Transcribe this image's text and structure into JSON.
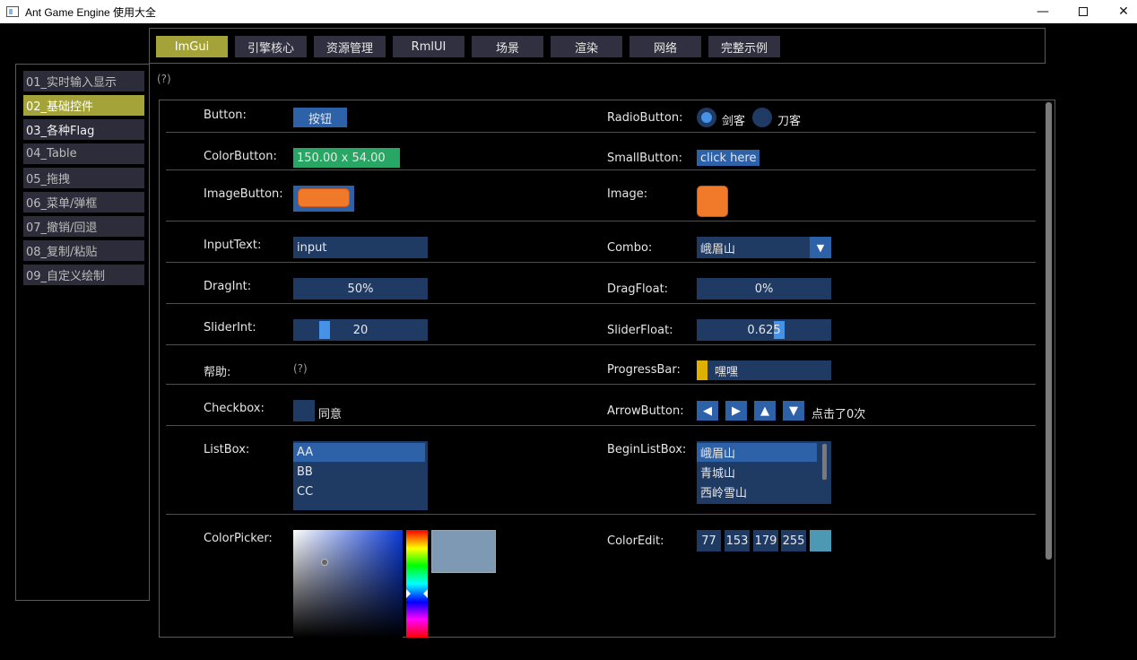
{
  "window": {
    "title": "Ant Game Engine 使用大全",
    "min_glyph": "—",
    "close_glyph": "✕"
  },
  "top_tabs": [
    {
      "label": "ImGui",
      "active": true
    },
    {
      "label": "引擎核心"
    },
    {
      "label": "资源管理"
    },
    {
      "label": "RmlUI"
    },
    {
      "label": "场景"
    },
    {
      "label": "渲染"
    },
    {
      "label": "网络"
    },
    {
      "label": "完整示例"
    }
  ],
  "sidebar": [
    {
      "label": "01_实时输入显示"
    },
    {
      "label": "02_基础控件",
      "active": true
    },
    {
      "label": "03_各种Flag"
    },
    {
      "label": "04_Table"
    },
    {
      "label": "05_拖拽"
    },
    {
      "label": "06_菜单/弹框"
    },
    {
      "label": "07_撤销/回退"
    },
    {
      "label": "08_复制/粘贴"
    },
    {
      "label": "09_自定义绘制"
    }
  ],
  "help_marker": "(?)",
  "left": {
    "button_label": "Button:",
    "button_text": "按钮",
    "colorbutton_label": "ColorButton:",
    "colorbutton_text": "150.00 x 54.00",
    "colorbutton_color": "#27a763",
    "imagebutton_label": "ImageButton:",
    "inputtext_label": "InputText:",
    "inputtext_value": "input",
    "dragint_label": "DragInt:",
    "dragint_value": "50%",
    "sliderint_label": "SliderInt:",
    "sliderint_value": "20",
    "help_label": "帮助:",
    "help_value": "(?)",
    "checkbox_label": "Checkbox:",
    "checkbox_text": "同意",
    "listbox_label": "ListBox:",
    "listbox_items": [
      "AA",
      "BB",
      "CC"
    ],
    "colorpicker_label": "ColorPicker:",
    "colorpicker_preview": "#7d99b3"
  },
  "right": {
    "radiobutton_label": "RadioButton:",
    "radio_options": [
      "剑客",
      "刀客"
    ],
    "radio_selected": 0,
    "smallbutton_label": "SmallButton:",
    "smallbutton_text": "click here",
    "image_label": "Image:",
    "combo_label": "Combo:",
    "combo_value": "峨眉山",
    "combo_arrow": "▼",
    "dragfloat_label": "DragFloat:",
    "dragfloat_value": "0%",
    "sliderfloat_label": "SliderFloat:",
    "sliderfloat_value": "0.625",
    "progressbar_label": "ProgressBar:",
    "progressbar_text": "嘿嘿",
    "progressbar_fraction": 0.08,
    "arrowbutton_label": "ArrowButton:",
    "arrow_glyphs": [
      "◀",
      "▶",
      "▲",
      "▼"
    ],
    "arrow_status": "点击了0次",
    "beginlistbox_label": "BeginListBox:",
    "beginlistbox_items": [
      "峨眉山",
      "青城山",
      "西岭雪山"
    ],
    "coloredit_label": "ColorEdit:",
    "coloredit_values": [
      "77",
      "153",
      "179",
      "255"
    ],
    "coloredit_swatch": "#4d99b3"
  },
  "colors": {
    "accent_active": "#a3a33a",
    "widget_bg": "#1f3a63",
    "button_bg": "#2d61a8",
    "orange": "#f07a2a"
  }
}
